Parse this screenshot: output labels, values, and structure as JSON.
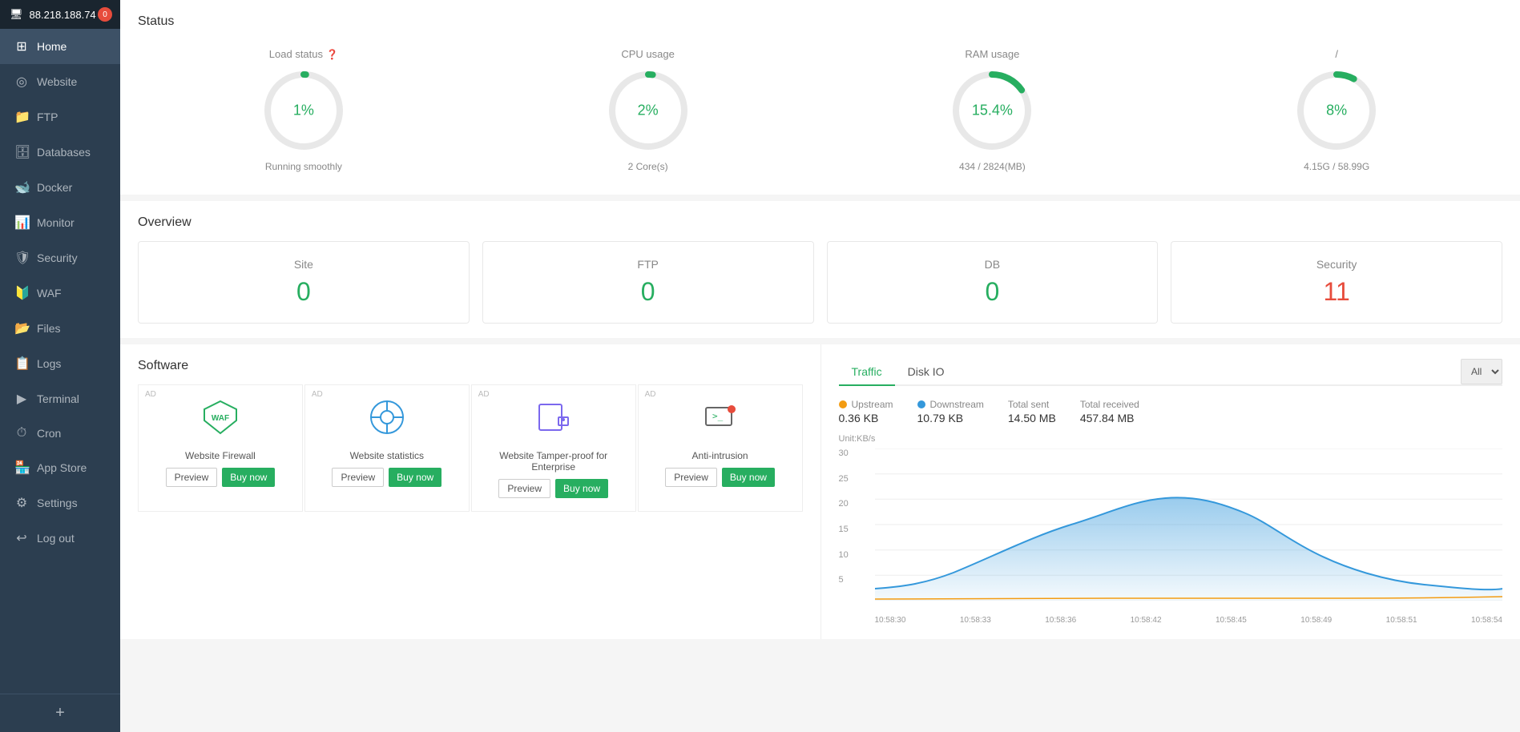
{
  "sidebar": {
    "ip": "88.218.188.74",
    "badge": "0",
    "items": [
      {
        "label": "Home",
        "icon": "🏠",
        "active": true
      },
      {
        "label": "Website",
        "icon": "🌐"
      },
      {
        "label": "FTP",
        "icon": "📁"
      },
      {
        "label": "Databases",
        "icon": "🗄"
      },
      {
        "label": "Docker",
        "icon": "🐳"
      },
      {
        "label": "Monitor",
        "icon": "📊"
      },
      {
        "label": "Security",
        "icon": "🛡"
      },
      {
        "label": "WAF",
        "icon": "🔰"
      },
      {
        "label": "Files",
        "icon": "📂"
      },
      {
        "label": "Logs",
        "icon": "📋"
      },
      {
        "label": "Terminal",
        "icon": "💻"
      },
      {
        "label": "Cron",
        "icon": "⏱"
      },
      {
        "label": "App Store",
        "icon": "⚙"
      },
      {
        "label": "Settings",
        "icon": "⚙"
      },
      {
        "label": "Log out",
        "icon": "🚪"
      }
    ],
    "add_label": "+"
  },
  "status": {
    "title": "Status",
    "cards": [
      {
        "label": "Load status",
        "has_help": true,
        "value": "1%",
        "sublabel": "Running smoothly"
      },
      {
        "label": "CPU usage",
        "has_help": false,
        "value": "2%",
        "sublabel": "2 Core(s)"
      },
      {
        "label": "RAM usage",
        "has_help": false,
        "value": "15.4%",
        "sublabel": "434 / 2824(MB)"
      },
      {
        "label": "/",
        "has_help": false,
        "value": "8%",
        "sublabel": "4.15G / 58.99G"
      }
    ]
  },
  "overview": {
    "title": "Overview",
    "cards": [
      {
        "label": "Site",
        "value": "0",
        "red": false
      },
      {
        "label": "FTP",
        "value": "0",
        "red": false
      },
      {
        "label": "DB",
        "value": "0",
        "red": false
      },
      {
        "label": "Security",
        "value": "11",
        "red": true
      }
    ]
  },
  "software": {
    "title": "Software",
    "items": [
      {
        "name": "Website Firewall",
        "icon_type": "waf"
      },
      {
        "name": "Website statistics",
        "icon_type": "stats"
      },
      {
        "name": "Website Tamper-proof for Enterprise",
        "icon_type": "tamper"
      },
      {
        "name": "Anti-intrusion",
        "icon_type": "anti"
      }
    ],
    "preview_label": "Preview",
    "buy_label": "Buy now",
    "ad_label": "AD"
  },
  "traffic": {
    "tabs": [
      "Traffic",
      "Disk IO"
    ],
    "active_tab": 0,
    "select_options": [
      "All"
    ],
    "select_value": "All",
    "stats": [
      {
        "label": "Upstream",
        "dot": "orange",
        "value": "0.36 KB"
      },
      {
        "label": "Downstream",
        "dot": "blue",
        "value": "10.79 KB"
      },
      {
        "label": "Total sent",
        "dot": null,
        "value": "14.50 MB"
      },
      {
        "label": "Total received",
        "dot": null,
        "value": "457.84 MB"
      }
    ],
    "unit_label": "Unit:KB/s",
    "y_labels": [
      "30",
      "25",
      "20",
      "15",
      "10",
      "5",
      ""
    ],
    "x_labels": [
      "10:58:30",
      "10:58:33",
      "10:58:36",
      "10:58:42",
      "10:58:45",
      "10:58:49",
      "10:58:51",
      "10:58:54"
    ]
  }
}
